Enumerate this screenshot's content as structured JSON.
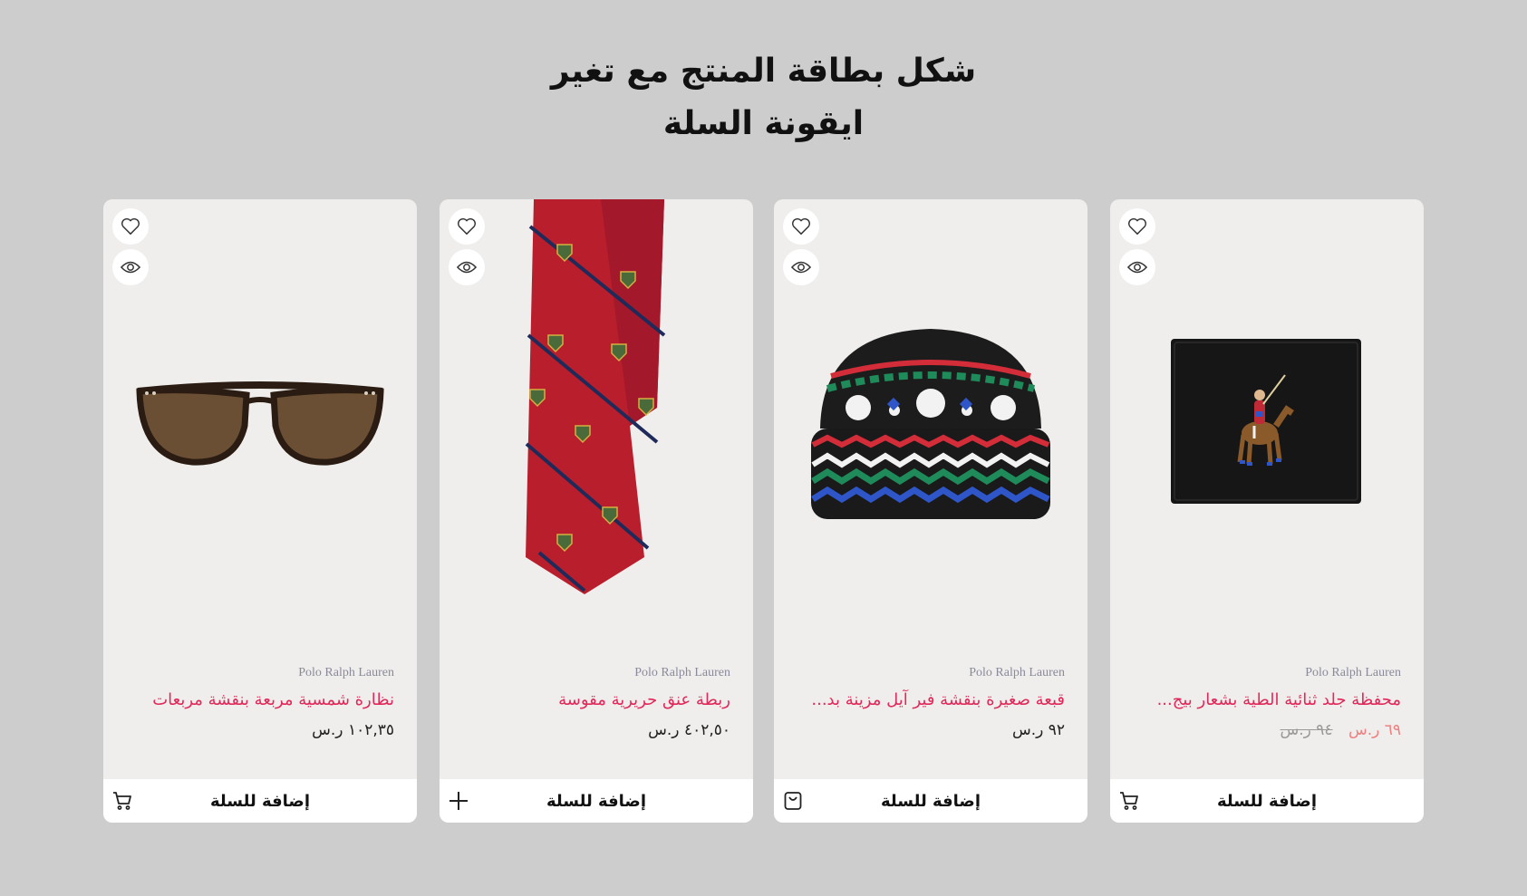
{
  "page": {
    "title_line1": "شكل بطاقة المنتج مع تغير",
    "title_line2": "ايقونة السلة",
    "background": "#cdcdcd"
  },
  "colors": {
    "accent": "#e0285a",
    "sale": "#f08080",
    "brand_text": "#8a8a9a",
    "card_bg": "#f0eeec"
  },
  "cards": [
    {
      "image": "sunglasses",
      "wish_icon": "heart-icon",
      "view_icon": "eye-icon",
      "brand": "Polo Ralph Lauren",
      "name": "نظارة شمسية مربعة بنقشة مربعات",
      "price": "١٠٢,٣٥ ر.س",
      "old_price": "",
      "cart_label": "إضافة للسلة",
      "cart_icon": "cart-icon"
    },
    {
      "image": "silk-tie",
      "wish_icon": "heart-icon",
      "view_icon": "eye-icon",
      "brand": "Polo Ralph Lauren",
      "name": "ربطة عنق حريرية مقوسة",
      "price": "٤٠٢,٥٠ ر.س",
      "old_price": "",
      "cart_label": "إضافة للسلة",
      "cart_icon": "plus-icon"
    },
    {
      "image": "fair-isle-beanie",
      "wish_icon": "heart-icon",
      "view_icon": "eye-icon",
      "brand": "Polo Ralph Lauren",
      "name": "قبعة صغيرة بنقشة فير آيل مزينة بد...",
      "price": "٩٢ ر.س",
      "old_price": "",
      "cart_label": "إضافة للسلة",
      "cart_icon": "shopping-bag-icon"
    },
    {
      "image": "leather-wallet",
      "wish_icon": "heart-icon",
      "view_icon": "eye-icon",
      "brand": "Polo Ralph Lauren",
      "name": "محفظة جلد ثنائية الطية بشعار بيج...",
      "price": "٦٩ ر.س",
      "old_price": "٩٤ ر.س",
      "cart_label": "إضافة للسلة",
      "cart_icon": "cart-icon"
    }
  ]
}
